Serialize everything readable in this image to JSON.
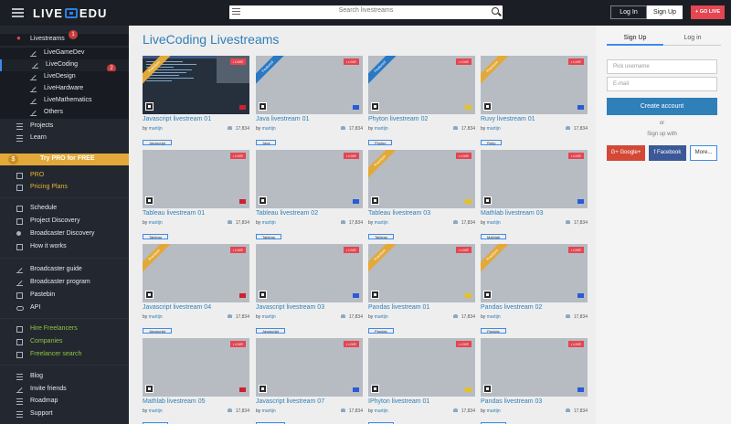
{
  "topbar": {
    "logo_left": "LIVE",
    "logo_right": "EDU",
    "search_placeholder": "Search livestreams",
    "login_label": "Log In",
    "signup_label": "Sign Up",
    "golive_label": "+ GO LIVE"
  },
  "sidebar": {
    "livestreams": "Livestreams",
    "subs": [
      "LiveGameDev",
      "LiveCoding",
      "LiveDesign",
      "LiveHardware",
      "LiveMathematics",
      "Others"
    ],
    "projects": "Projects",
    "learn": "Learn",
    "pro_banner": "Try PRO for FREE",
    "pro": "PRO",
    "pricing": "Pricing Plans",
    "group2": [
      "Schedule",
      "Project Discovery",
      "Broadcaster Discovery",
      "How it works"
    ],
    "group3": [
      "Broadcaster guide",
      "Broadcaster program",
      "Pastebin",
      "API"
    ],
    "group4": [
      "Hire Freelancers",
      "Companies",
      "Freelancer search"
    ],
    "group5": [
      "Blog",
      "Invite friends",
      "Roadmap",
      "Support"
    ],
    "badge1": "1",
    "badge2": "2"
  },
  "main": {
    "title": "LiveCoding Livestreams",
    "live_label": "• LIVE",
    "by_label": "by",
    "cards": [
      {
        "title": "Javascript livestream 01",
        "author": "martijn",
        "views": "17,834",
        "tag": "Javascript",
        "ribbon": "Premium"
      },
      {
        "title": "Java livestream 01",
        "author": "martijn",
        "views": "17,834",
        "tag": "Java",
        "ribbon": "Featured"
      },
      {
        "title": "Phyton livestream 02",
        "author": "martijn",
        "views": "17,834",
        "tag": "Phyton",
        "ribbon": "Featured"
      },
      {
        "title": "Ruvy livestream 01",
        "author": "martijn",
        "views": "17,834",
        "tag": "Ruby",
        "ribbon": "Premium"
      },
      {
        "title": "Tableau livestream 01",
        "author": "martijn",
        "views": "17,834",
        "tag": "Tableau",
        "ribbon": ""
      },
      {
        "title": "Tableau livestream 02",
        "author": "martijn",
        "views": "17,834",
        "tag": "Tableau",
        "ribbon": ""
      },
      {
        "title": "Tableau livestream 03",
        "author": "martijn",
        "views": "17,834",
        "tag": "Tableau",
        "ribbon": "Premium"
      },
      {
        "title": "Mathlab livestream 03",
        "author": "martijn",
        "views": "17,834",
        "tag": "Mathlab",
        "ribbon": ""
      },
      {
        "title": "Javascript livestream 04",
        "author": "martijn",
        "views": "17,834",
        "tag": "Javascript",
        "ribbon": "Premium"
      },
      {
        "title": "Javascript livestream 03",
        "author": "martijn",
        "views": "17,834",
        "tag": "Javascript",
        "ribbon": ""
      },
      {
        "title": "Pandas livestream 01",
        "author": "martijn",
        "views": "17,834",
        "tag": "Pandas",
        "ribbon": "Premium"
      },
      {
        "title": "Pandas livestream 02",
        "author": "martijn",
        "views": "17,834",
        "tag": "Pandas",
        "ribbon": "Premium"
      },
      {
        "title": "Mathlab livestream 05",
        "author": "martijn",
        "views": "17,834",
        "tag": "Mathlab",
        "ribbon": ""
      },
      {
        "title": "Javascript livestream 07",
        "author": "martijn",
        "views": "17,834",
        "tag": "Javascript",
        "ribbon": ""
      },
      {
        "title": "IPhyton livestream 01",
        "author": "martijn",
        "views": "17,834",
        "tag": "IpHyton",
        "ribbon": ""
      },
      {
        "title": "Pandas livestream 03",
        "author": "martijn",
        "views": "17,834",
        "tag": "Pandas",
        "ribbon": ""
      }
    ]
  },
  "panel": {
    "tab_signup": "Sign Up",
    "tab_login": "Log in",
    "username_placeholder": "Pick username",
    "email_placeholder": "E-mail",
    "create_label": "Create account",
    "or_label": "or",
    "signwith_label": "Sign up with",
    "google_label": "G+ Google+",
    "facebook_label": "f  Facebook",
    "more_label": "More..."
  },
  "colors": {
    "accent": "#2f7fb8",
    "live": "#e44652",
    "premium": "#e2a93a",
    "featured": "#2b78c4"
  }
}
